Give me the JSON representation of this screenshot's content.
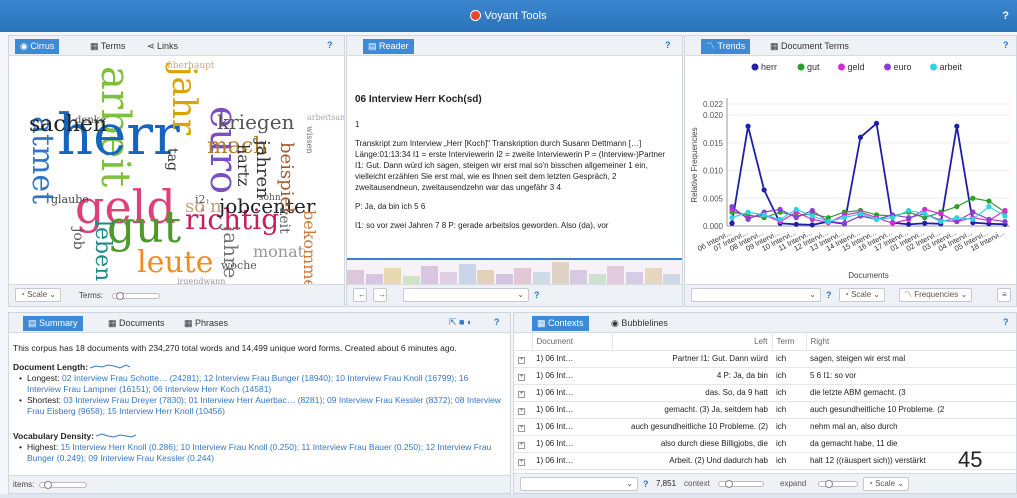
{
  "app": {
    "title": "Voyant Tools",
    "help": "?"
  },
  "cirrus": {
    "tabs": [
      "Cirrus",
      "Terms",
      "Links"
    ],
    "help": "?",
    "scale_label": "Scale",
    "terms_label": "Terms:",
    "words": [
      "arbeit",
      "herr",
      "geld",
      "gut",
      "atmet",
      "sachen",
      "jahr",
      "euro",
      "kriegen",
      "mach",
      "richtig",
      "leute",
      "jobcenter",
      "jahren",
      "beispiel",
      "hartz",
      "zeit",
      "monat",
      "jahre",
      "woche",
      "leben",
      "job",
      "so'n",
      "überhaupt",
      "bekommen",
      "glaube",
      "denke",
      "wissen",
      "arbeitsamt",
      "tag",
      "i2",
      "sohn",
      "irgendwann"
    ]
  },
  "reader": {
    "tab": "Reader",
    "help": "?",
    "title": "06 Interview Herr Koch(sd)",
    "page": "1",
    "para1": "Transkript zum Interview „Herr [Koch]\" Transkription durch Susann Dettmann […] Länge:01:13:34 I1 = erste Interviewerin I2 = zweite Interviewerin P = (Interview-)Partner I1: Gut. Dann würd ich sagen, steigen wir erst mal so'n bisschen allgemeiner 1 ein, vielleicht erzählen Sie erst mal, wie es Ihnen seit dem letzten Gespräch, 2 zweitausendneun, zweitausendzehn war das ungefähr 3 4",
    "para2": "P: Ja, da bin ich 5 6",
    "para3": "I1: so vor zwei Jahren 7 8 P: gerade arbeitslos geworden. Also (da), vor"
  },
  "trends": {
    "tabs": [
      "Trends",
      "Document Terms"
    ],
    "help": "?",
    "scale_label": "Scale",
    "freq_label": "Frequencies",
    "ylabel": "Relative Frequencies",
    "xlabel": "Documents",
    "legend": [
      {
        "name": "herr",
        "color": "#1f1fa8"
      },
      {
        "name": "gut",
        "color": "#2ca02c"
      },
      {
        "name": "geld",
        "color": "#d62ad6"
      },
      {
        "name": "euro",
        "color": "#8a3fd0"
      },
      {
        "name": "arbeit",
        "color": "#2fd3e0"
      }
    ],
    "yticks": [
      "0.022",
      "0.020",
      "0.015",
      "0.010",
      "0.005",
      "0.000"
    ]
  },
  "chart_data": {
    "type": "line",
    "title": "",
    "xlabel": "Documents",
    "ylabel": "Relative Frequencies",
    "ylim": [
      0,
      0.022
    ],
    "x": [
      "06 Intervi...",
      "07 Intervi...",
      "08 Intervi...",
      "09 Intervi...",
      "10 Intervi...",
      "11 Intervi...",
      "12 Intervi...",
      "13 Intervi...",
      "14 Intervi...",
      "15 Intervi...",
      "16 Intervi...",
      "17 Intervi...",
      "01 Intervi...",
      "02 Intervi...",
      "03 Intervi...",
      "04 Intervi...",
      "05 Intervi...",
      "18 Intervi..."
    ],
    "series": [
      {
        "name": "herr",
        "values": [
          0.0005,
          0.018,
          0.0065,
          0.0005,
          0.0003,
          0.0002,
          0.0008,
          0.0004,
          0.016,
          0.0185,
          0.0006,
          0.0003,
          0.0005,
          0.0004,
          0.018,
          0.0006,
          0.0004,
          0.0003
        ]
      },
      {
        "name": "gut",
        "values": [
          0.0025,
          0.002,
          0.0015,
          0.0025,
          0.0018,
          0.0022,
          0.0015,
          0.0025,
          0.0028,
          0.002,
          0.0018,
          0.0025,
          0.0015,
          0.0025,
          0.0035,
          0.005,
          0.0045,
          0.0025
        ]
      },
      {
        "name": "geld",
        "values": [
          0.003,
          0.0015,
          0.002,
          0.0008,
          0.0025,
          0.0012,
          0.0006,
          0.002,
          0.0025,
          0.0015,
          0.0005,
          0.0012,
          0.003,
          0.0022,
          0.0008,
          0.0015,
          0.001,
          0.0028
        ]
      },
      {
        "name": "euro",
        "values": [
          0.0035,
          0.0012,
          0.0025,
          0.003,
          0.0015,
          0.0028,
          0.0008,
          0.0005,
          0.0018,
          0.0012,
          0.002,
          0.0015,
          0.0022,
          0.001,
          0.0008,
          0.0025,
          0.0012,
          0.0008
        ]
      },
      {
        "name": "arbeit",
        "values": [
          0.0015,
          0.0025,
          0.002,
          0.0012,
          0.003,
          0.0018,
          0.0008,
          0.0015,
          0.0022,
          0.0012,
          0.0015,
          0.0028,
          0.0022,
          0.0008,
          0.0015,
          0.0012,
          0.0035,
          0.0018
        ]
      }
    ]
  },
  "summary": {
    "tabs": [
      "Summary",
      "Documents",
      "Phrases"
    ],
    "help": "?",
    "intro": "This corpus has 18 documents with 234,270 total words and 14,499 unique word forms. Created about 6 minutes ago.",
    "len_title": "Document Length:",
    "longest_label": "Longest:",
    "longest": "02 Interview Frau Schotte… (24281); 12 Interview Frau Bunger (18940); 10 Interview Frau Knoll (16799); 16 Interview Frau Lampner (16151); 06 Interview Herr Koch (14581)",
    "shortest_label": "Shortest:",
    "shortest": "03 Interview Frau Dreyer (7830); 01 Interview Herr Auerbac… (8281); 09 Interview Frau Kessler (8372); 08 Interview Frau Eisberg (9658); 15 Interview Herr Knoll (10456)",
    "dens_title": "Vocabulary Density:",
    "highest_label": "Highest:",
    "highest": "15 Interview Herr Knoll (0.286); 10 Interview Frau Knoll (0.250); 11 Interview Frau Bauer (0.250); 12 Interview Frau Bunger (0.249); 09 Interview Frau Kessler (0.244)",
    "items_label": "items:"
  },
  "contexts": {
    "tabs": [
      "Contexts",
      "Bubblelines"
    ],
    "help": "?",
    "cols": [
      "Document",
      "Left",
      "Term",
      "Right"
    ],
    "rows": [
      {
        "doc": "1) 06 Int…",
        "left": "Partner I1: Gut. Dann würd",
        "term": "ich",
        "right": "sagen, steigen wir erst mal"
      },
      {
        "doc": "1) 06 Int…",
        "left": "4 P: Ja, da bin",
        "term": "ich",
        "right": "5 6 I1: so vor"
      },
      {
        "doc": "1) 06 Int…",
        "left": "das. So, da 9 hatt",
        "term": "ich",
        "right": "die letzte ABM gemacht. (3"
      },
      {
        "doc": "1) 06 Int…",
        "left": "gemacht. (3) Ja, seitdem hab",
        "term": "ich",
        "right": "auch gesundheitliche 10 Probleme. (2"
      },
      {
        "doc": "1) 06 Int…",
        "left": "auch gesundheitliche 10 Probleme. (2)",
        "term": "ich",
        "right": "nehm mal an, also durch"
      },
      {
        "doc": "1) 06 Int…",
        "left": "also durch diese Billigjobs, die",
        "term": "ich",
        "right": "da gemacht habe, 11 die"
      },
      {
        "doc": "1) 06 Int…",
        "left": "Arbeit. (2) Und dadurch hab",
        "term": "ich",
        "right": "halt 12 ((räuspert sich)) verstärkt"
      }
    ],
    "count": "7,851",
    "context_label": "context",
    "expand_label": "expand",
    "scale_label": "Scale",
    "overlay": "45"
  }
}
